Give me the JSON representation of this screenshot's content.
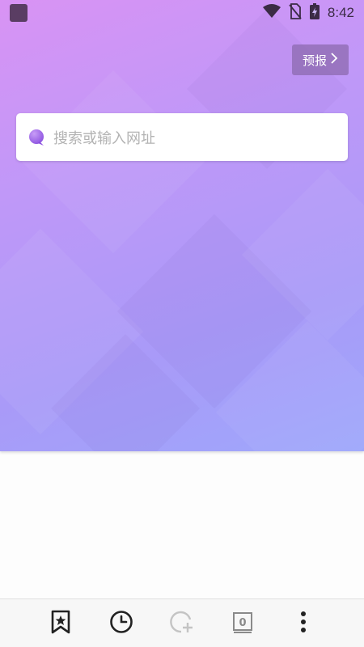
{
  "status_bar": {
    "time": "8:42",
    "icons": [
      "app-indicator-icon",
      "wifi-icon",
      "no-sim-icon",
      "battery-charging-icon"
    ]
  },
  "header": {
    "preview_label": "预报",
    "preview_icon": "chevron-right-icon"
  },
  "search": {
    "placeholder": "搜索或输入网址",
    "icon": "purple-bubble-icon"
  },
  "bottom_nav": {
    "items": [
      "bookmarks-star-icon",
      "history-clock-icon",
      "new-tab-add-icon",
      "tab-counter-icon",
      "more-menu-icon"
    ],
    "tab_count": "0"
  },
  "colors": {
    "gradient_start": "#d993f4",
    "gradient_end": "#9ea7fb",
    "accent_purple": "#9a5de5",
    "icon_dark": "#222222",
    "icon_disabled": "#c4c4c4"
  }
}
